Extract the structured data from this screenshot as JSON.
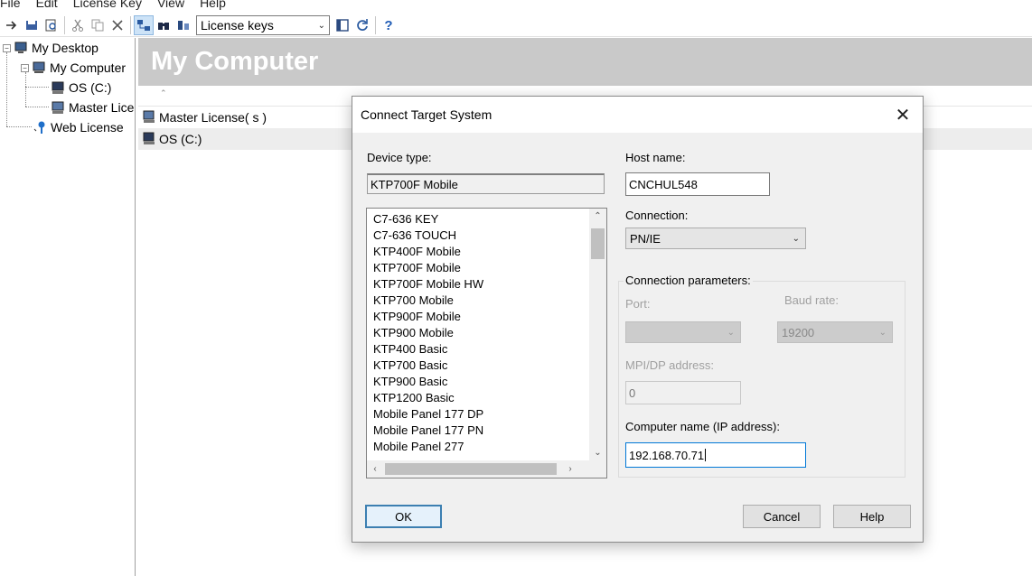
{
  "menu": [
    "File",
    "Edit",
    "License Key",
    "View",
    "Help"
  ],
  "toolbar": {
    "icons": [
      "transfer-icon",
      "save-icon",
      "print-preview-icon",
      "cut-icon",
      "copy-icon",
      "delete-icon",
      "connect-target-icon",
      "binoculars-icon",
      "filter-icon",
      "window-icon",
      "refresh-icon",
      "help-icon"
    ],
    "view_select": "License keys"
  },
  "tree": {
    "root": "My Desktop",
    "computer": "My Computer",
    "os": "OS (C:)",
    "master": "Master Lice",
    "web": "Web License"
  },
  "right": {
    "title": "My Computer",
    "rows": [
      "Master License( s )",
      "OS (C:)"
    ]
  },
  "dialog": {
    "title": "Connect Target System",
    "device_type_label": "Device type:",
    "device_type_value": "KTP700F Mobile",
    "devices": [
      "C7-636 KEY",
      "C7-636 TOUCH",
      "KTP400F Mobile",
      "KTP700F Mobile",
      "KTP700F Mobile HW",
      "KTP700 Mobile",
      "KTP900F Mobile",
      "KTP900 Mobile",
      "KTP400 Basic",
      "KTP700 Basic",
      "KTP900 Basic",
      "KTP1200 Basic",
      "Mobile Panel 177 DP",
      "Mobile Panel 177 PN",
      "Mobile Panel 277"
    ],
    "host_label": "Host name:",
    "host_value": "CNCHUL548",
    "connection_label": "Connection:",
    "connection_value": "PN/IE",
    "params_label": "Connection parameters:",
    "port_label": "Port:",
    "port_value": "",
    "baud_label": "Baud rate:",
    "baud_value": "19200",
    "mpi_label": "MPI/DP address:",
    "mpi_value": "0",
    "computer_label": "Computer name (IP address):",
    "computer_value": "192.168.70.71",
    "ok": "OK",
    "cancel": "Cancel",
    "help": "Help"
  }
}
